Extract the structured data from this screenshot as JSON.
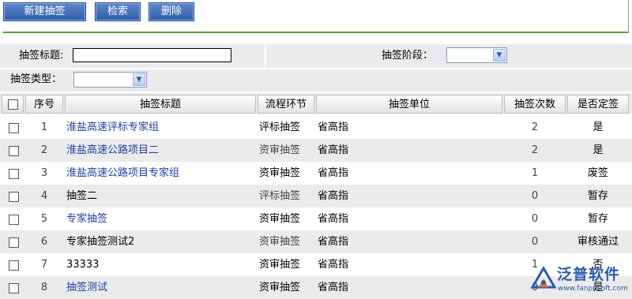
{
  "toolbar": {
    "new_label": "新建抽签",
    "search_label": "检索",
    "delete_label": "删除"
  },
  "search": {
    "title_label": "抽签标题:",
    "title_value": "",
    "stage_label": "抽签阶段：",
    "stage_value": "",
    "type_label": "抽签类型：",
    "type_value": ""
  },
  "table": {
    "columns": [
      "",
      "序号",
      "抽签标题",
      "流程环节",
      "抽签单位",
      "抽签次数",
      "是否定签"
    ],
    "rows": [
      {
        "no": "1",
        "title": "淮盐高速评标专家组",
        "stage": "评标抽签",
        "unit": "省高指",
        "count": "2",
        "status": "是"
      },
      {
        "no": "2",
        "title": "淮盐高速公路项目二",
        "stage": "资审抽签",
        "unit": "省高指",
        "count": "2",
        "status": "是"
      },
      {
        "no": "3",
        "title": "淮盐高速公路项目专家组",
        "stage": "资审抽签",
        "unit": "省高指",
        "count": "1",
        "status": "废签"
      },
      {
        "no": "4",
        "title": "抽签二",
        "stage": "评标抽签",
        "unit": "省高指",
        "count": "0",
        "status": "暂存"
      },
      {
        "no": "5",
        "title": "专家抽签",
        "stage": "资审抽签",
        "unit": "省高指",
        "count": "0",
        "status": "暂存"
      },
      {
        "no": "6",
        "title": "专家抽签测试2",
        "stage": "资审抽签",
        "unit": "省高指",
        "count": "0",
        "status": "审核通过"
      },
      {
        "no": "7",
        "title": "33333",
        "stage": "资审抽签",
        "unit": "省高指",
        "count": "1",
        "status": "否"
      },
      {
        "no": "8",
        "title": "抽签测试",
        "stage": "资审抽签",
        "unit": "省高指",
        "count": "0",
        "status": "是"
      }
    ]
  },
  "watermark": {
    "brand": "泛普软件",
    "url": "www.fanpusoft.com"
  },
  "colors": {
    "link": "#1d3ea8",
    "button": "#2f5ea8",
    "rule": "#5aa02c",
    "alt_row": "#ebebeb"
  }
}
